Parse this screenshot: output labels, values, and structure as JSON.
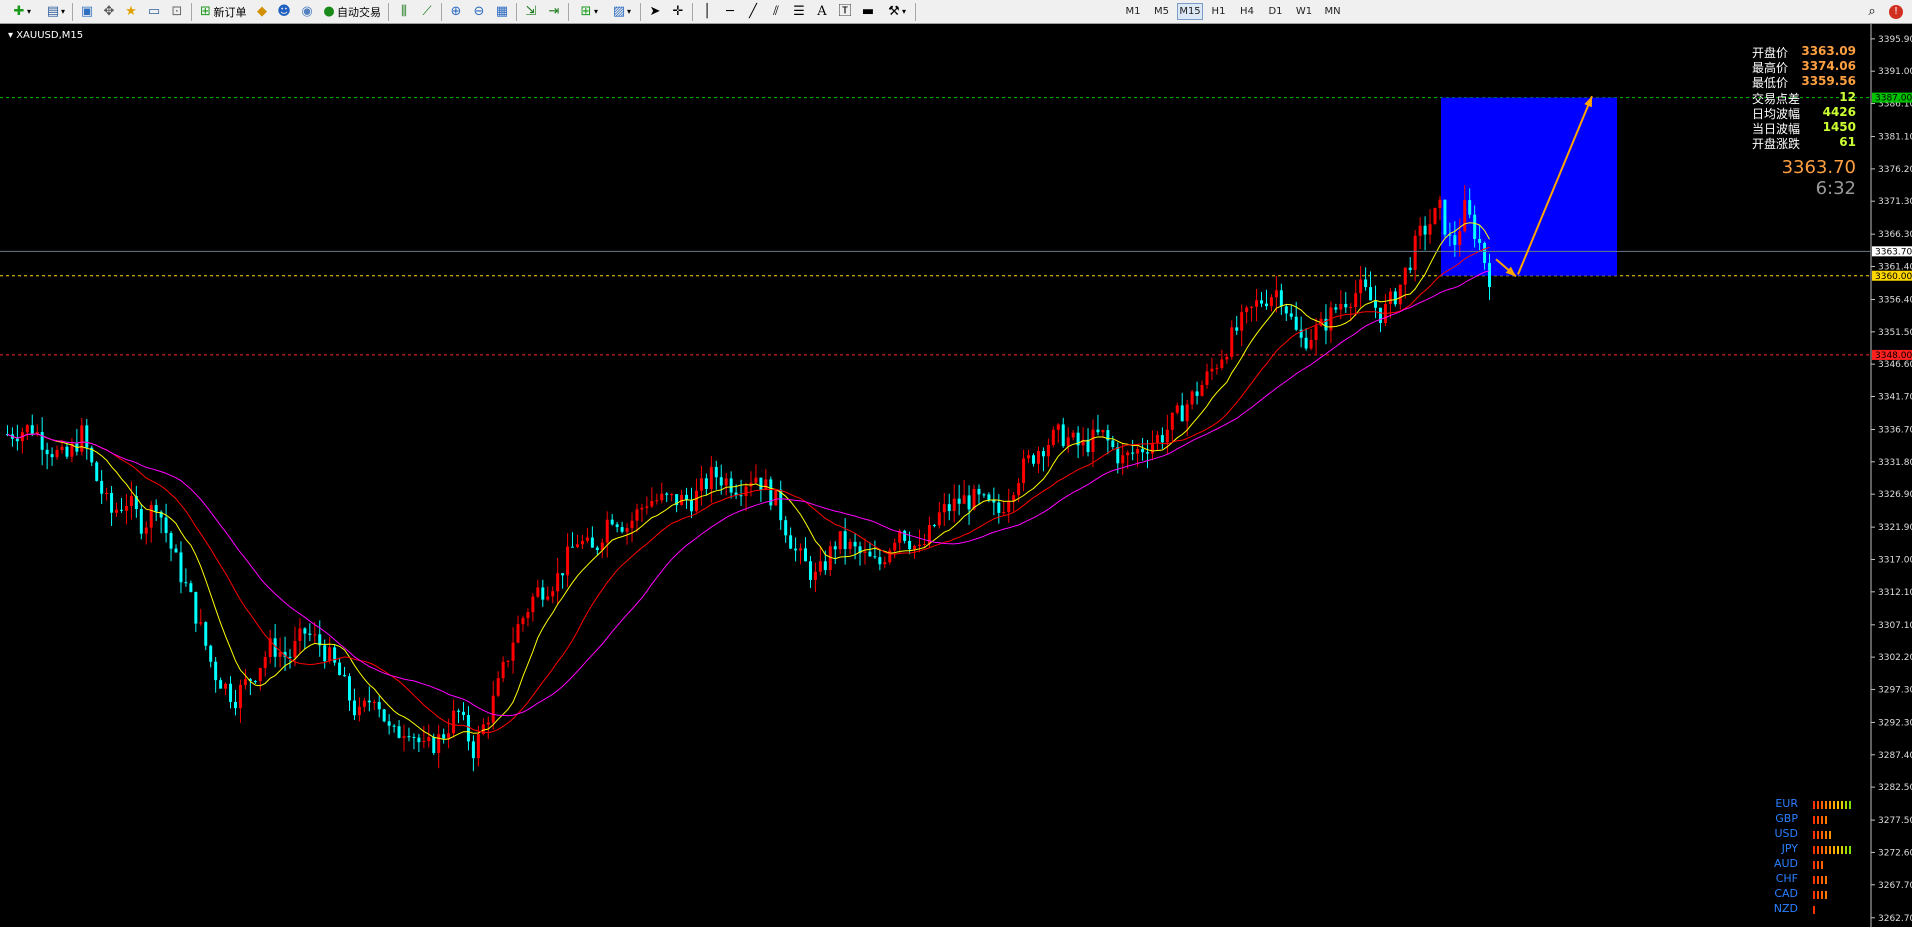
{
  "toolbar": {
    "new_order_label": "新订单",
    "auto_trade_label": "自动交易",
    "timeframes": [
      "M1",
      "M5",
      "M15",
      "H1",
      "H4",
      "D1",
      "W1",
      "MN"
    ],
    "active_timeframe": "M15"
  },
  "chart": {
    "symbol_title": "XAUUSD,M15",
    "y_axis_ticks": [
      "3395.90",
      "3391.00",
      "3386.10",
      "3381.10",
      "3376.20",
      "3371.30",
      "3366.30",
      "3361.40",
      "3356.40",
      "3351.50",
      "3346.60",
      "3341.70",
      "3336.70",
      "3331.80",
      "3326.90",
      "3321.90",
      "3317.00",
      "3312.10",
      "3307.10",
      "3302.20",
      "3297.30",
      "3292.30",
      "3287.40",
      "3282.50",
      "3277.50",
      "3272.60",
      "3267.70",
      "3262.70"
    ],
    "y_range": [
      3261.3,
      3397.7
    ],
    "horizontal_lines": [
      {
        "price": 3387.0,
        "color": "#00c000",
        "label": "3387.00"
      },
      {
        "price": 3360.0,
        "color": "#ffd700",
        "label": "3360.00"
      },
      {
        "price": 3348.0,
        "color": "#ff2020",
        "label": "3348.00"
      }
    ],
    "bid_line": {
      "price": 3363.7,
      "label": "3363.70"
    },
    "colors": {
      "bull": "#ff0000",
      "bear": "#00ffff",
      "ma_fast": "#ffff00",
      "ma_mid": "#ff0000",
      "ma_slow": "#ff00ff",
      "box": "#0000ff",
      "arrow": "#ffa500"
    }
  },
  "info_panel": {
    "rows": [
      {
        "label": "开盘价",
        "value": "3363.09"
      },
      {
        "label": "最高价",
        "value": "3374.06"
      },
      {
        "label": "最低价",
        "value": "3359.56"
      },
      {
        "label": "交易点差",
        "value": "12"
      },
      {
        "label": "日均波幅",
        "value": "4426"
      },
      {
        "label": "当日波幅",
        "value": "1450"
      },
      {
        "label": "开盘涨跌",
        "value": "61"
      }
    ],
    "current_price": "3363.70",
    "countdown": "6:32"
  },
  "currency_strength": [
    {
      "name": "EUR",
      "bars": 10
    },
    {
      "name": "GBP",
      "bars": 4
    },
    {
      "name": "USD",
      "bars": 5
    },
    {
      "name": "JPY",
      "bars": 10
    },
    {
      "name": "AUD",
      "bars": 3
    },
    {
      "name": "CHF",
      "bars": 4
    },
    {
      "name": "CAD",
      "bars": 4
    },
    {
      "name": "NZD",
      "bars": 1
    }
  ]
}
